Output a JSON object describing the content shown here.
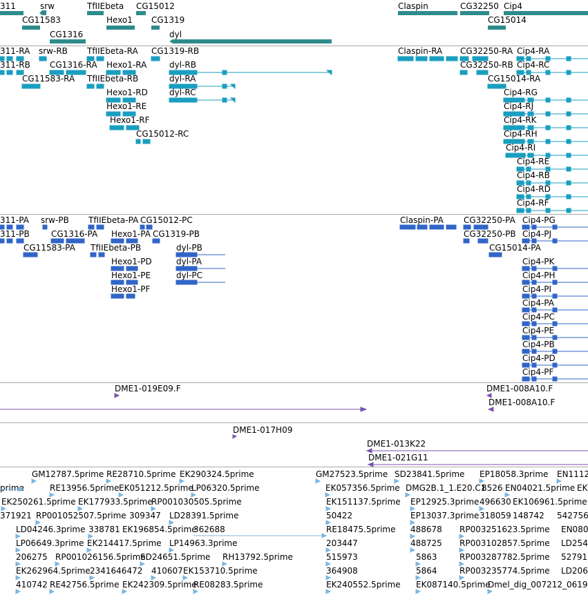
{
  "colors": {
    "gene": "#2e8b8b",
    "transcript": "#1a9ec0",
    "cds": "#3166c8",
    "clone": "#7b52ae",
    "est": "#7cb6e0",
    "separator": "#a8a8a8"
  },
  "tracks": {
    "genes": {
      "labels": [
        "311",
        "srw",
        "TfIIEbeta",
        "CG15012",
        "Claspin",
        "CG32250",
        "Cip4",
        "CG11583",
        "Hexo1",
        "CG1319",
        "CG15014",
        "CG1316",
        "dyl"
      ]
    },
    "transcripts": {
      "labels": [
        "311-RA",
        "srw-RB",
        "TfIIEbeta-RA",
        "CG1319-RB",
        "Claspin-RA",
        "CG32250-RA",
        "Cip4-RA",
        "311-RB",
        "CG1316-RA",
        "Hexo1-RA",
        "dyl-RB",
        "CG32250-RB",
        "Cip4-RC",
        "CG11583-RA",
        "TfIIEbeta-RB",
        "dyl-RA",
        "CG15014-RA",
        "Hexo1-RD",
        "dyl-RC",
        "Cip4-RG",
        "Hexo1-RE",
        "Cip4-RJ",
        "Hexo1-RF",
        "Cip4-RK",
        "CG15012-RC",
        "Cip4-RH",
        "Cip4-RI",
        "Cip4-RE",
        "Cip4-RB",
        "Cip4-RD",
        "Cip4-RF"
      ]
    },
    "proteins": {
      "labels": [
        "311-PA",
        "srw-PB",
        "TfIIEbeta-PA",
        "CG15012-PC",
        "Claspin-PA",
        "CG32250-PA",
        "Cip4-PG",
        "311-PB",
        "CG1316-PA",
        "Hexo1-PA",
        "CG1319-PB",
        "CG32250-PB",
        "Cip4-PJ",
        "CG11583-PA",
        "TfIIEbeta-PB",
        "dyl-PB",
        "CG15014-PA",
        "Hexo1-PD",
        "dyl-PA",
        "Cip4-PK",
        "Hexo1-PE",
        "dyl-PC",
        "Cip4-PH",
        "Hexo1-PF",
        "Cip4-PI",
        "Cip4-PA",
        "Cip4-PC",
        "Cip4-PE",
        "Cip4-PB",
        "Cip4-PD",
        "Cip4-PF"
      ]
    },
    "clones_a": {
      "labels": [
        "DME1-019E09.F",
        "DME1-008A10.F",
        "DME1-008A10.F"
      ]
    },
    "clones_b": {
      "labels": [
        "DME1-017H09",
        "DME1-013K22",
        "DME1-021G11"
      ]
    },
    "ests": {
      "labels": [
        "GM12787.5prime",
        "RE28710.5prime",
        "EK290324.5prime",
        "GM27523.5prime",
        "SD23841.5prime",
        "EP18058.3prime",
        "EN11124",
        "prime",
        "RE13956.5prime",
        "EK051212.5prime",
        "LP06320.5prime",
        "EK057356.5prime",
        "DMG2B.1_1.E20.C1",
        "8526",
        "EN04021.5prime",
        "EK",
        "EK250261.5prime",
        "EK177933.5prime",
        "RP001030505.5prime",
        "EK151137.5prime",
        "EP12925.3prime",
        "496630",
        "EK106961.5prime",
        "371921",
        "RP001052507.5prime",
        "309347",
        "LD28391.5prime",
        "50422",
        "EP13037.3prime",
        "318059",
        "148742",
        "542756",
        "LD04246.3prime",
        "338781",
        "EK196854.5prime",
        "362688",
        "RE18475.5prime",
        "488678",
        "RP003251623.5prime",
        "EN080",
        "LP06649.3prime",
        "EK214417.5prime",
        "LP14963.3prime",
        "203447",
        "488725",
        "RP003102857.5prime",
        "LD254",
        "206275",
        "RP001026156.5prime",
        "SD24651.5prime",
        "RH13792.5prime",
        "515973",
        "5863",
        "RP003287782.5prime",
        "52791",
        "EK262964.5prime",
        "2341646472",
        "410607",
        "EK153710.5prime",
        "364908",
        "5864",
        "RP003235774.5prime",
        "LD206",
        "410742",
        "RE42756.5prime",
        "EK242309.5prime",
        "RE08283.5prime",
        "EK240552.5prime",
        "EK087140.5prime",
        "Dmel_dig_007212_0619"
      ]
    }
  }
}
